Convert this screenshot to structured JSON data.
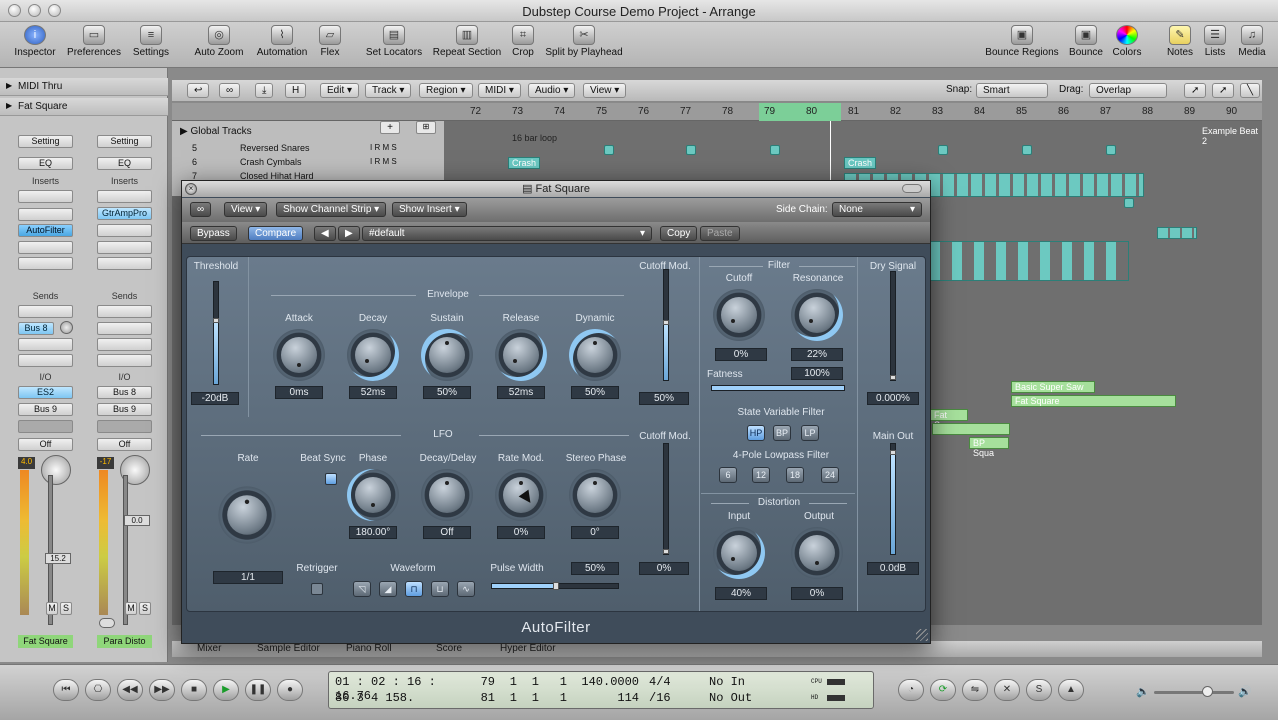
{
  "window": {
    "title": "Dubstep Course Demo Project - Arrange"
  },
  "toolbar": {
    "buttons": [
      {
        "label": "Inspector",
        "icon": "info-icon"
      },
      {
        "label": "Preferences",
        "icon": "switch-icon"
      },
      {
        "label": "Settings",
        "icon": "settings-icon"
      },
      {
        "label": "Auto Zoom",
        "icon": "zoom-icon"
      },
      {
        "label": "Automation",
        "icon": "automation-icon"
      },
      {
        "label": "Flex",
        "icon": "flex-icon"
      },
      {
        "label": "Set Locators",
        "icon": "locators-icon"
      },
      {
        "label": "Repeat Section",
        "icon": "repeat-icon"
      },
      {
        "label": "Crop",
        "icon": "crop-icon"
      },
      {
        "label": "Split by Playhead",
        "icon": "split-icon"
      },
      {
        "label": "Bounce Regions",
        "icon": "bounce-regions-icon"
      },
      {
        "label": "Bounce",
        "icon": "bounce-icon"
      },
      {
        "label": "Colors",
        "icon": "colors-icon"
      },
      {
        "label": "Notes",
        "icon": "notes-icon"
      },
      {
        "label": "Lists",
        "icon": "lists-icon"
      },
      {
        "label": "Media",
        "icon": "media-icon"
      }
    ]
  },
  "inspector": {
    "rows": [
      "MIDI Thru",
      "Fat Square"
    ],
    "strip1": {
      "setting": "Setting",
      "eq": "EQ",
      "inserts": "Inserts",
      "insert1": "AutoFilter",
      "sends": "Sends",
      "send1": "Bus 8",
      "io": "I/O",
      "input": "ES2",
      "output": "Bus 9",
      "automation": "Off",
      "peak": "4.0",
      "meter_value": "15.2",
      "name": "Fat Square"
    },
    "strip2": {
      "setting": "Setting",
      "eq": "EQ",
      "inserts": "Inserts",
      "insert1": "GtrAmpPro",
      "sends": "Sends",
      "io": "I/O",
      "input": "Bus 8",
      "output": "Bus 9",
      "automation": "Off",
      "peak": "-17",
      "meter_value": "0.0",
      "name": "Para Disto"
    },
    "mute": "M",
    "solo": "S"
  },
  "arrange": {
    "menus": [
      "Edit",
      "Track",
      "Region",
      "MIDI",
      "Audio",
      "View"
    ],
    "snap_label": "Snap:",
    "snap_value": "Smart",
    "drag_label": "Drag:",
    "drag_value": "Overlap",
    "ruler": [
      "72",
      "73",
      "74",
      "75",
      "76",
      "77",
      "78",
      "79",
      "80",
      "81",
      "82",
      "83",
      "84",
      "85",
      "86",
      "87",
      "88",
      "89",
      "90"
    ],
    "global_tracks": "Global Tracks",
    "loop_label": "16 bar loop",
    "marker_right": "Example Beat 2",
    "tracks": [
      {
        "num": "5",
        "name": "Reversed Snares"
      },
      {
        "num": "6",
        "name": "Crash Cymbals"
      },
      {
        "num": "7",
        "name": "Closed Hihat Hard"
      }
    ],
    "regions": {
      "crash1": "Crash",
      "crash2": "Crash",
      "supersaw": "Basic Super Saw",
      "fatsquare": "Fat Square",
      "fatsqua": "Fat Squa",
      "bpsqua": "BP Squa"
    }
  },
  "plugin": {
    "title": "Fat Square",
    "view": "View",
    "channel_strip": "Show Channel Strip",
    "show_insert": "Show Insert",
    "side_chain_label": "Side Chain:",
    "side_chain_value": "None",
    "bypass": "Bypass",
    "compare": "Compare",
    "preset": "#default",
    "copy": "Copy",
    "paste": "Paste",
    "name": "AutoFilter",
    "threshold": {
      "label": "Threshold",
      "value": "-20dB"
    },
    "envelope": {
      "label": "Envelope",
      "knobs": [
        {
          "label": "Attack",
          "value": "0ms"
        },
        {
          "label": "Decay",
          "value": "52ms"
        },
        {
          "label": "Sustain",
          "value": "50%"
        },
        {
          "label": "Release",
          "value": "52ms"
        },
        {
          "label": "Dynamic",
          "value": "50%"
        }
      ]
    },
    "cutoff_mod_env": {
      "label": "Cutoff Mod.",
      "value": "50%"
    },
    "lfo": {
      "label": "LFO",
      "rate_label": "Rate",
      "rate_value": "1/1",
      "beat_sync": "Beat Sync",
      "knobs": [
        {
          "label": "Phase",
          "value": "180.00°"
        },
        {
          "label": "Decay/Delay",
          "value": "Off"
        },
        {
          "label": "Rate Mod.",
          "value": "0%"
        },
        {
          "label": "Stereo Phase",
          "value": "0°"
        }
      ],
      "retrigger": "Retrigger",
      "waveform": "Waveform",
      "pulse_width": "Pulse Width",
      "pulse_value": "50%"
    },
    "cutoff_mod_lfo": {
      "label": "Cutoff Mod.",
      "value": "0%"
    },
    "filter": {
      "label": "Filter",
      "cutoff_label": "Cutoff",
      "cutoff_value": "0%",
      "resonance_label": "Resonance",
      "resonance_value": "22%",
      "fatness_label": "Fatness",
      "fatness_value": "100%"
    },
    "state_var": {
      "label": "State Variable Filter",
      "buttons": [
        "HP",
        "BP",
        "LP"
      ]
    },
    "pole": {
      "label": "4-Pole Lowpass Filter",
      "buttons": [
        "6",
        "12",
        "18",
        "24"
      ]
    },
    "distortion": {
      "label": "Distortion",
      "input_label": "Input",
      "input_value": "40%",
      "output_label": "Output",
      "output_value": "0%"
    },
    "dry": {
      "label": "Dry Signal",
      "value": "0.000%"
    },
    "main_out": {
      "label": "Main Out",
      "value": "0.0dB"
    }
  },
  "bottom_tabs": [
    "Mixer",
    "Sample Editor",
    "Piano Roll",
    "Score",
    "Hyper Editor"
  ],
  "transport": {
    "position_top": "01 : 02 : 16 : 16.76",
    "position_bot": "80   3   4  158.",
    "bars_top": [
      "79",
      "1",
      "1",
      "1"
    ],
    "bars_bot": [
      "81",
      "1",
      "1",
      "1"
    ],
    "tempo": "140.0000",
    "tempo_bot": "114",
    "sig_top": "4/4",
    "sig_bot": "/16",
    "in": "No In",
    "out": "No Out",
    "cpu": "CPU",
    "hd": "HD"
  }
}
